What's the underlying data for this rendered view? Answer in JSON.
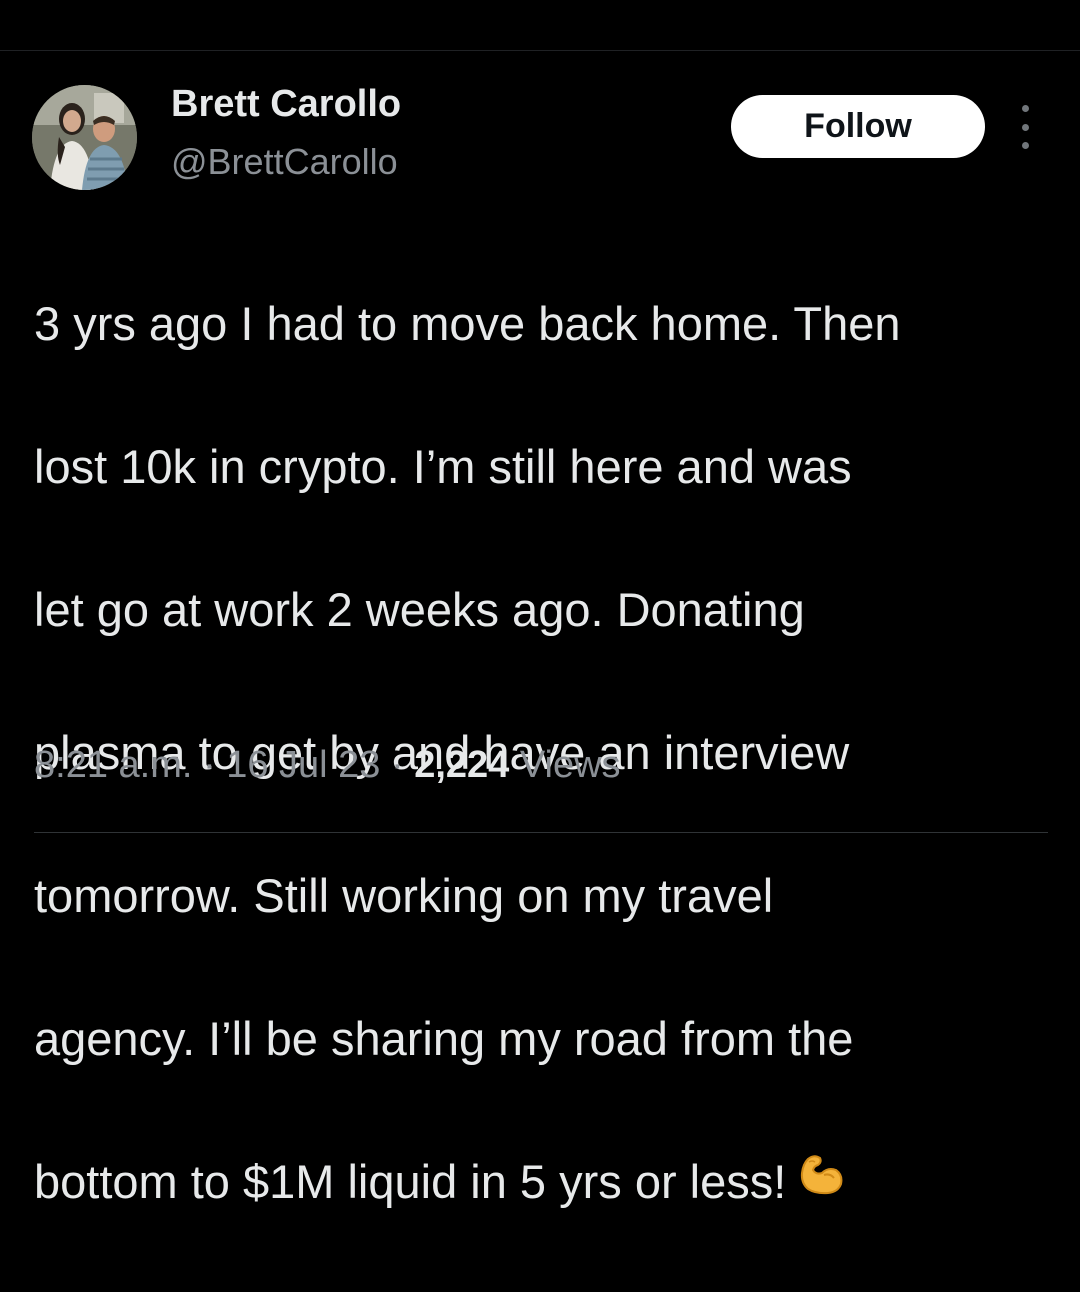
{
  "author": {
    "display_name": "Brett Carollo",
    "handle": "@BrettCarollo",
    "avatar_alt": "profile photo"
  },
  "actions": {
    "follow_label": "Follow",
    "more_icon": "more-vertical-icon"
  },
  "tweet": {
    "lines": [
      "3 yrs ago I had to move back home. Then",
      "lost 10k in crypto. I’m still here and was",
      "let go at work 2 weeks ago. Donating",
      "plasma to get by and have an interview",
      "tomorrow. Still working on my travel",
      "agency. I’ll be sharing my road from the",
      "bottom to $1M liquid in 5 yrs or less!"
    ],
    "emoji": "flexed-biceps-icon"
  },
  "meta": {
    "time": "8:21 a.m.",
    "separator": "·",
    "date": "16 Jul 23",
    "views_count": "2,224",
    "views_label": "Views"
  },
  "colors": {
    "background": "#000000",
    "primary_text": "#e7e9ea",
    "secondary_text": "#8b9096",
    "follow_bg": "#ffffff",
    "follow_text": "#0f1419",
    "divider": "#2f3336"
  }
}
